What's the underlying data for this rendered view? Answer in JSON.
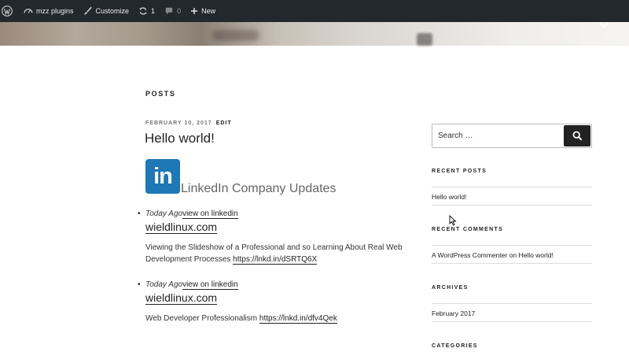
{
  "admin_bar": {
    "site_name": "mzz plugins",
    "customize": "Customize",
    "updates_count": "1",
    "comments_count": "0",
    "new_label": "New"
  },
  "main": {
    "page_title": "POSTS",
    "post": {
      "date": "FEBRUARY 10, 2017",
      "edit": "EDIT",
      "title": "Hello world!"
    },
    "linkedin": {
      "logo_text": "in",
      "heading": "LinkedIn Company Updates",
      "items": [
        {
          "ago": "Today Ago",
          "link": "view on linkedin",
          "domain": "wieldlinux.com",
          "desc": "Viewing the Slideshow of a Professional and so Learning About Real Web Development Processes",
          "url": "https://lnkd.in/dSRTQ6X"
        },
        {
          "ago": "Today Ago",
          "link": "view on linkedin",
          "domain": "wieldlinux.com",
          "desc": "Web Developer Professionalism",
          "url": "https://lnkd.in/dfv4Qek"
        }
      ]
    }
  },
  "sidebar": {
    "search_placeholder": "Search …",
    "recent_posts_title": "RECENT POSTS",
    "recent_posts": [
      "Hello world!"
    ],
    "recent_comments_title": "RECENT COMMENTS",
    "comment": {
      "author": "A WordPress Commenter",
      "on": "on",
      "post": "Hello world!"
    },
    "archives_title": "ARCHIVES",
    "archives": [
      "February 2017"
    ],
    "categories_title": "CATEGORIES"
  },
  "colors": {
    "admin_bar": "#23282d",
    "linkedin_blue": "#1d78b5",
    "text": "#222222"
  },
  "icons": [
    "wordpress-icon",
    "dashboard-icon",
    "brush-icon",
    "updates-icon",
    "comment-icon",
    "plus-icon",
    "search-icon",
    "chevron-down-icon",
    "cursor-icon"
  ]
}
